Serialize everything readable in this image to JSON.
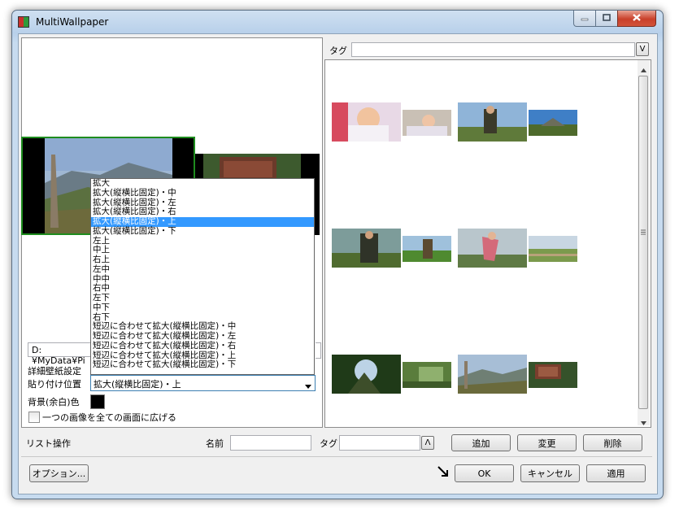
{
  "window": {
    "title": "MultiWallpaper"
  },
  "preview": {
    "path_text": "D:¥MyData¥Pi"
  },
  "settings": {
    "detail_label": "詳細壁紙設定",
    "paste_label": "貼り付け位置",
    "paste_value": "拡大(縦横比固定)・上",
    "bg_label": "背景(余白)色",
    "bg_color": "#000000",
    "spread_label": "一つの画像を全ての画面に広げる"
  },
  "dropdown": {
    "options": [
      "拡大",
      "拡大(縦横比固定)・中",
      "拡大(縦横比固定)・左",
      "拡大(縦横比固定)・右",
      "拡大(縦横比固定)・上",
      "拡大(縦横比固定)・下",
      "左上",
      "中上",
      "右上",
      "左中",
      "中中",
      "右中",
      "左下",
      "中下",
      "右下",
      "短辺に合わせて拡大(縦横比固定)・中",
      "短辺に合わせて拡大(縦横比固定)・左",
      "短辺に合わせて拡大(縦横比固定)・右",
      "短辺に合わせて拡大(縦横比固定)・上",
      "短辺に合わせて拡大(縦横比固定)・下"
    ],
    "selected": "拡大(縦横比固定)・上"
  },
  "tag_filter": {
    "label": "タグ",
    "value": "",
    "toggle": "V"
  },
  "list_ops": {
    "label": "リスト操作",
    "name_label": "名前",
    "tag_label": "タグ",
    "up_button": "Λ",
    "add": "追加",
    "change": "変更",
    "delete": "削除"
  },
  "footer": {
    "options": "オプション...",
    "ok": "OK",
    "cancel": "キャンセル",
    "apply": "適用"
  },
  "colors": {
    "selection": "#3399ff",
    "title_gradient": "#b8d0ea"
  }
}
